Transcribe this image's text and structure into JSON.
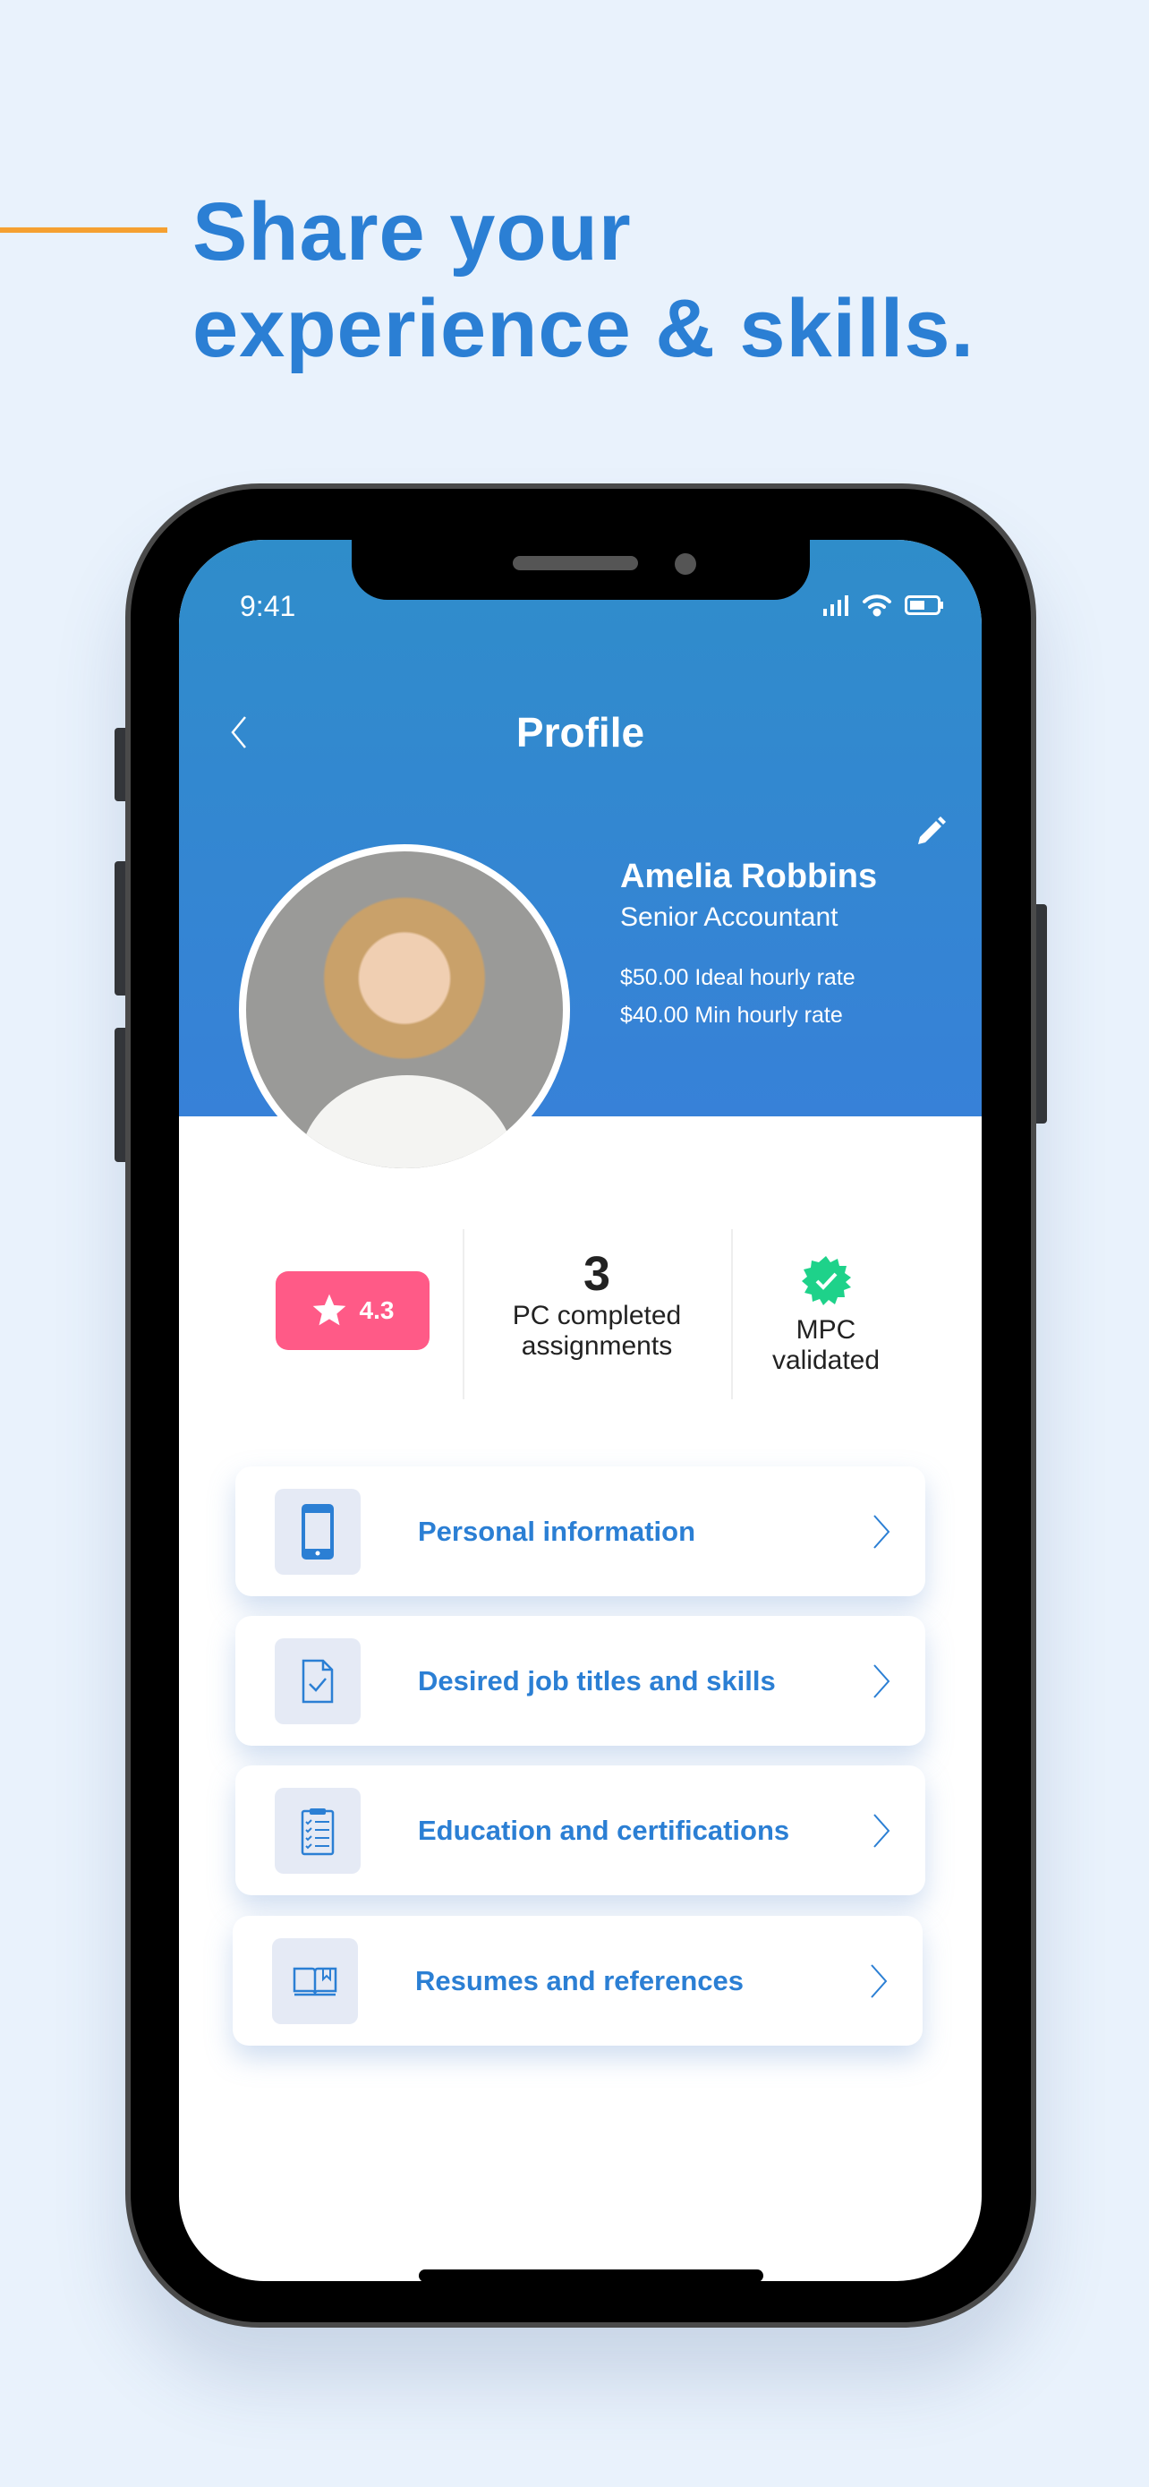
{
  "headline": {
    "line1": "Share your",
    "line2": "experience & skills."
  },
  "status_bar": {
    "time": "9:41",
    "icons": [
      "signal-icon",
      "wifi-icon",
      "battery-icon"
    ]
  },
  "header": {
    "title": "Profile",
    "back_icon": "chevron-left-icon",
    "edit_icon": "pencil-icon"
  },
  "profile": {
    "name": "Amelia Robbins",
    "role": "Senior Accountant",
    "ideal_rate": "$50.00 Ideal hourly rate",
    "min_rate": "$40.00 Min hourly rate"
  },
  "stats": {
    "rating": "4.3",
    "completed_count": "3",
    "completed_label_1": "PC completed",
    "completed_label_2": "assignments",
    "validated_label_1": "MPC",
    "validated_label_2": "validated"
  },
  "menu": [
    {
      "label": "Personal information",
      "icon": "phone-icon"
    },
    {
      "label": "Desired job titles and skills",
      "icon": "document-check-icon"
    },
    {
      "label": "Education and certifications",
      "icon": "clipboard-list-icon"
    },
    {
      "label": "Resumes and references",
      "icon": "book-icon"
    }
  ],
  "colors": {
    "accent": "#2b7fd4",
    "rating": "#ff5a87",
    "validated": "#1ed28a",
    "orange": "#f5a031"
  }
}
